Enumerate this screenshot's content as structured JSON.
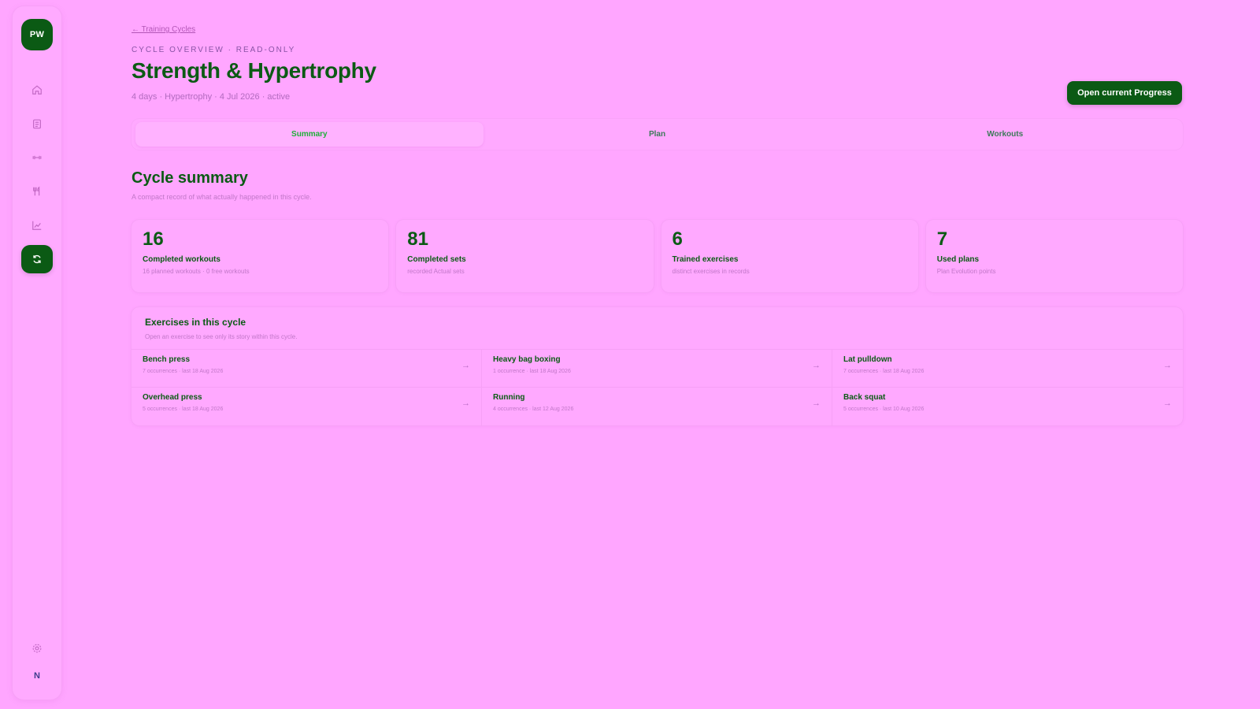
{
  "sidebar": {
    "logo": "PW",
    "avatar": "N",
    "items": [
      {
        "name": "home-icon"
      },
      {
        "name": "clipboard-icon"
      },
      {
        "name": "dumbbell-icon"
      },
      {
        "name": "utensils-icon"
      },
      {
        "name": "chart-icon"
      },
      {
        "name": "cycle-icon",
        "active": true
      },
      {
        "name": "settings-icon"
      }
    ]
  },
  "header": {
    "back_link": "← Training Cycles",
    "eyebrow": "CYCLE OVERVIEW · READ-ONLY",
    "title": "Strength & Hypertrophy",
    "meta": "4 days · Hypertrophy · 4 Jul 2026 · active",
    "primary_button": "Open current Progress"
  },
  "tabs": [
    {
      "label": "Summary",
      "active": true
    },
    {
      "label": "Plan",
      "active": false
    },
    {
      "label": "Workouts",
      "active": false
    }
  ],
  "summary": {
    "title": "Cycle summary",
    "subtitle": "A compact record of what actually happened in this cycle.",
    "stats": [
      {
        "value": "16",
        "label": "Completed workouts",
        "desc": "16 planned workouts · 0 free workouts"
      },
      {
        "value": "81",
        "label": "Completed sets",
        "desc": "recorded Actual sets"
      },
      {
        "value": "6",
        "label": "Trained exercises",
        "desc": "distinct exercises in records"
      },
      {
        "value": "7",
        "label": "Used plans",
        "desc": "Plan Evolution points"
      }
    ]
  },
  "exercises": {
    "title": "Exercises in this cycle",
    "subtitle": "Open an exercise to see only its story within this cycle.",
    "items": [
      {
        "name": "Bench press",
        "meta": "7 occurrences · last 18 Aug 2026"
      },
      {
        "name": "Heavy bag boxing",
        "meta": "1 occurrence · last 18 Aug 2026"
      },
      {
        "name": "Lat pulldown",
        "meta": "7 occurrences · last 18 Aug 2026"
      },
      {
        "name": "Overhead press",
        "meta": "5 occurrences · last 18 Aug 2026"
      },
      {
        "name": "Running",
        "meta": "4 occurrences · last 12 Aug 2026"
      },
      {
        "name": "Back squat",
        "meta": "5 occurrences · last 10 Aug 2026"
      }
    ],
    "arrow": "→"
  },
  "colors": {
    "background": "#ffa6ff",
    "brand": "#0b5a14",
    "active_tab_text": "#1fb03a"
  }
}
